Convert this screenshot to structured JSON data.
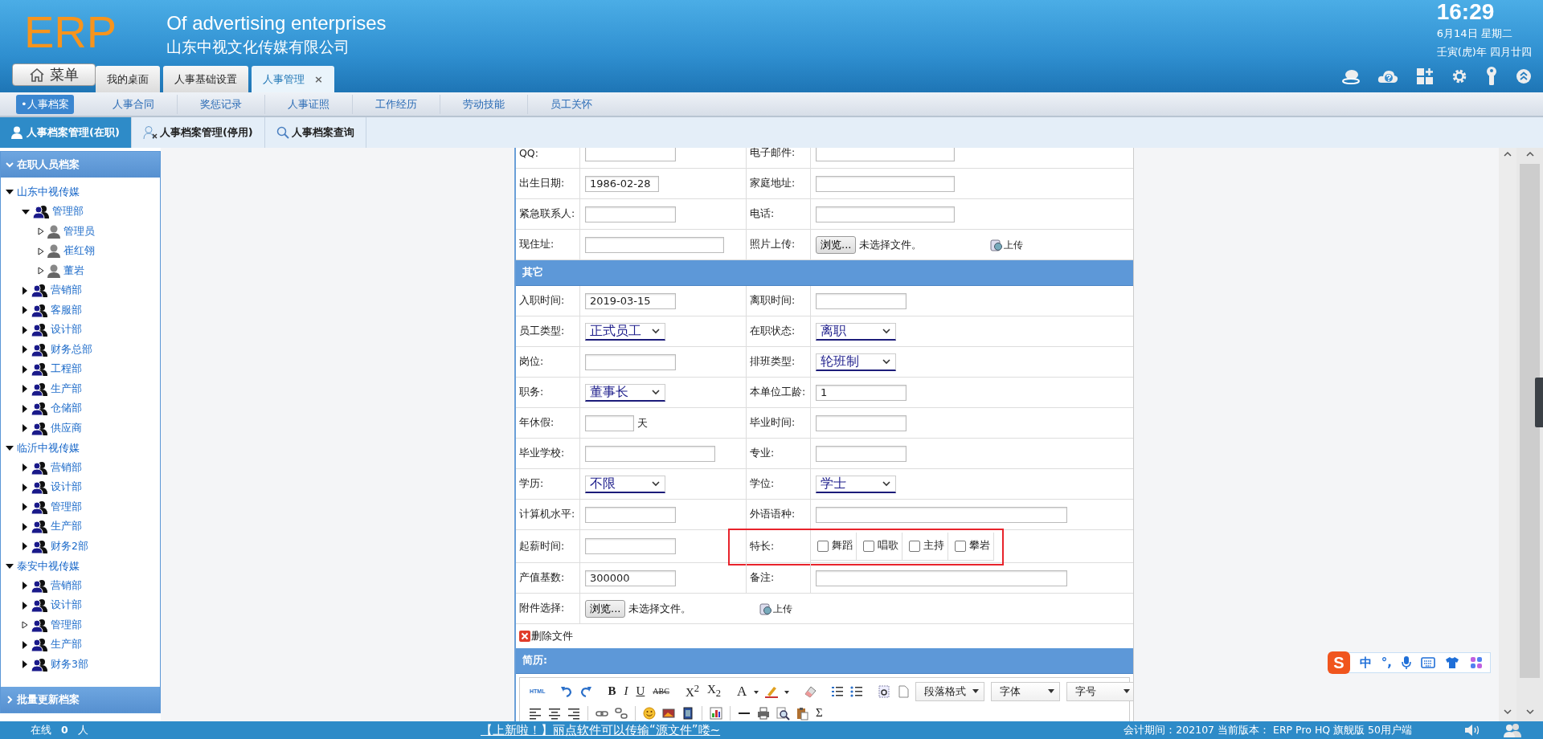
{
  "header": {
    "logo": "ERP",
    "title": "Of advertising enterprises",
    "company": "山东中视文化传媒有限公司",
    "time": "16:29",
    "date": "6月14日 星期二",
    "lunar": "壬寅(虎)年 四月廿四"
  },
  "menu_button": "菜单",
  "tabs": [
    {
      "label": "我的桌面",
      "selected": false
    },
    {
      "label": "人事基础设置",
      "selected": false
    },
    {
      "label": "人事管理",
      "selected": true,
      "close": "×"
    }
  ],
  "subnav": [
    {
      "label": "•人事档案",
      "selected": true
    },
    {
      "label": "人事合同",
      "selected": false
    },
    {
      "label": "奖惩记录",
      "selected": false
    },
    {
      "label": "人事证照",
      "selected": false
    },
    {
      "label": "工作经历",
      "selected": false
    },
    {
      "label": "劳动技能",
      "selected": false
    },
    {
      "label": "员工关怀",
      "selected": false
    }
  ],
  "page_tabs": [
    {
      "label": "人事档案管理(在职)",
      "selected": true
    },
    {
      "label": "人事档案管理(停用)",
      "selected": false
    },
    {
      "label": "人事档案查询",
      "selected": false
    }
  ],
  "sidebar": {
    "title": "在职人员档案",
    "expanded": true,
    "footer": "批量更新档案",
    "tree": [
      {
        "label": "山东中视传媒",
        "kind": "company",
        "expanded": true,
        "children": [
          {
            "label": "管理部",
            "kind": "dept",
            "expanded": true,
            "children": [
              {
                "label": "管理员",
                "kind": "person",
                "leaf": true
              },
              {
                "label": "崔红翎",
                "kind": "person",
                "leaf": true
              },
              {
                "label": "董岩",
                "kind": "person",
                "leaf": true
              }
            ]
          },
          {
            "label": "营销部",
            "kind": "dept",
            "expanded": false
          },
          {
            "label": "客服部",
            "kind": "dept",
            "expanded": false
          },
          {
            "label": "设计部",
            "kind": "dept",
            "expanded": false
          },
          {
            "label": "财务总部",
            "kind": "dept",
            "expanded": false
          },
          {
            "label": "工程部",
            "kind": "dept",
            "expanded": false
          },
          {
            "label": "生产部",
            "kind": "dept",
            "expanded": false
          },
          {
            "label": "仓储部",
            "kind": "dept",
            "expanded": false
          },
          {
            "label": "供应商",
            "kind": "dept",
            "expanded": false
          }
        ]
      },
      {
        "label": "临沂中视传媒",
        "kind": "company",
        "expanded": true,
        "children": [
          {
            "label": "营销部",
            "kind": "dept",
            "expanded": false
          },
          {
            "label": "设计部",
            "kind": "dept",
            "expanded": false
          },
          {
            "label": "管理部",
            "kind": "dept",
            "expanded": false
          },
          {
            "label": "生产部",
            "kind": "dept",
            "expanded": false
          },
          {
            "label": "财务2部",
            "kind": "dept",
            "expanded": false
          }
        ]
      },
      {
        "label": "泰安中视传媒",
        "kind": "company",
        "expanded": true,
        "children": [
          {
            "label": "营销部",
            "kind": "dept",
            "expanded": false
          },
          {
            "label": "设计部",
            "kind": "dept",
            "expanded": false
          },
          {
            "label": "管理部",
            "kind": "dept",
            "leaf": true
          },
          {
            "label": "生产部",
            "kind": "dept",
            "expanded": false
          },
          {
            "label": "财务3部",
            "kind": "dept",
            "expanded": false
          }
        ]
      }
    ]
  },
  "form": {
    "rows": [
      {
        "kind": "fields",
        "fields": [
          {
            "label": "QQ:",
            "kind": "input"
          },
          {
            "label": "电子邮件:",
            "kind": "input"
          }
        ]
      },
      {
        "kind": "fields",
        "fields": [
          {
            "label": "出生日期:",
            "kind": "input",
            "value": "1986-02-28"
          },
          {
            "label": "家庭地址:",
            "kind": "input"
          }
        ]
      },
      {
        "kind": "fields",
        "fields": [
          {
            "label": "紧急联系人:",
            "kind": "input"
          },
          {
            "label": "电话:",
            "kind": "input"
          }
        ]
      },
      {
        "kind": "fields",
        "fields": [
          {
            "label": "现住址:",
            "kind": "input"
          },
          {
            "label": "照片上传:",
            "kind": "file",
            "button": "浏览...",
            "status": "未选择文件。",
            "upload": "上传"
          }
        ]
      },
      {
        "kind": "section",
        "title": "其它"
      },
      {
        "kind": "fields",
        "fields": [
          {
            "label": "入职时间:",
            "kind": "input",
            "value": "2019-03-15"
          },
          {
            "label": "离职时间:",
            "kind": "input"
          }
        ]
      },
      {
        "kind": "fields",
        "fields": [
          {
            "label": "员工类型:",
            "kind": "select",
            "value": "正式员工"
          },
          {
            "label": "在职状态:",
            "kind": "select",
            "value": "离职"
          }
        ]
      },
      {
        "kind": "fields",
        "fields": [
          {
            "label": "岗位:",
            "kind": "input"
          },
          {
            "label": "排班类型:",
            "kind": "select",
            "value": "轮班制"
          }
        ]
      },
      {
        "kind": "fields",
        "fields": [
          {
            "label": "职务:",
            "kind": "select",
            "value": "董事长"
          },
          {
            "label": "本单位工龄:",
            "kind": "input",
            "value": "1"
          }
        ]
      },
      {
        "kind": "fields",
        "fields": [
          {
            "label": "年休假:",
            "kind": "input",
            "suffix": "天"
          },
          {
            "label": "毕业时间:",
            "kind": "input"
          }
        ]
      },
      {
        "kind": "fields",
        "fields": [
          {
            "label": "毕业学校:",
            "kind": "input"
          },
          {
            "label": "专业:",
            "kind": "input"
          }
        ]
      },
      {
        "kind": "fields",
        "fields": [
          {
            "label": "学历:",
            "kind": "select",
            "value": "不限"
          },
          {
            "label": "学位:",
            "kind": "select",
            "value": "学士"
          }
        ]
      },
      {
        "kind": "fields",
        "fields": [
          {
            "label": "计算机水平:",
            "kind": "input"
          },
          {
            "label": "外语语种:",
            "kind": "input"
          }
        ]
      },
      {
        "kind": "fields",
        "fields": [
          {
            "label": "起薪时间:",
            "kind": "input"
          },
          {
            "label": "特长:",
            "kind": "checks",
            "highlighted": true,
            "options": [
              {
                "label": "舞蹈",
                "checked": false
              },
              {
                "label": "唱歌",
                "checked": false
              },
              {
                "label": "主持",
                "checked": false
              },
              {
                "label": "攀岩",
                "checked": false
              }
            ]
          }
        ]
      },
      {
        "kind": "fields",
        "fields": [
          {
            "label": "产值基数:",
            "kind": "input",
            "value": "300000"
          },
          {
            "label": "备注:",
            "kind": "input"
          }
        ]
      },
      {
        "kind": "fields",
        "fields": [
          {
            "label": "附件选择:",
            "kind": "file",
            "button": "浏览...",
            "status": "未选择文件。",
            "upload": "上传"
          }
        ]
      },
      {
        "kind": "link",
        "label": "删除文件"
      },
      {
        "kind": "section",
        "title": "简历:"
      }
    ]
  },
  "editor": {
    "buttons": [
      {
        "label": "HTML",
        "kind": "tiny"
      },
      {
        "label": "B",
        "kind": "bold"
      },
      {
        "label": "I",
        "kind": "italic"
      },
      {
        "label": "U",
        "kind": "underline"
      },
      {
        "label": "ABC",
        "kind": "strike"
      },
      {
        "label": "X$^{2}$",
        "kind": "plain"
      },
      {
        "label": "X$_{2}$",
        "kind": "plain"
      },
      {
        "label": "A",
        "kind": "serif"
      },
      {
        "label": "Σ",
        "kind": "plain"
      }
    ],
    "dropdowns": [
      "段落格式",
      "字体",
      "字号"
    ]
  },
  "ime": {
    "logo": "S",
    "items": [
      "中",
      "°,"
    ]
  },
  "status_bar": {
    "online_label": "在线",
    "online_count": "0",
    "online_unit": "人",
    "notice": "【上新啦！】丽点软件可以传输“源文件”喽~",
    "info": "会计期间：202107 当前版本： ERP Pro HQ 旗舰版 50用户端"
  }
}
